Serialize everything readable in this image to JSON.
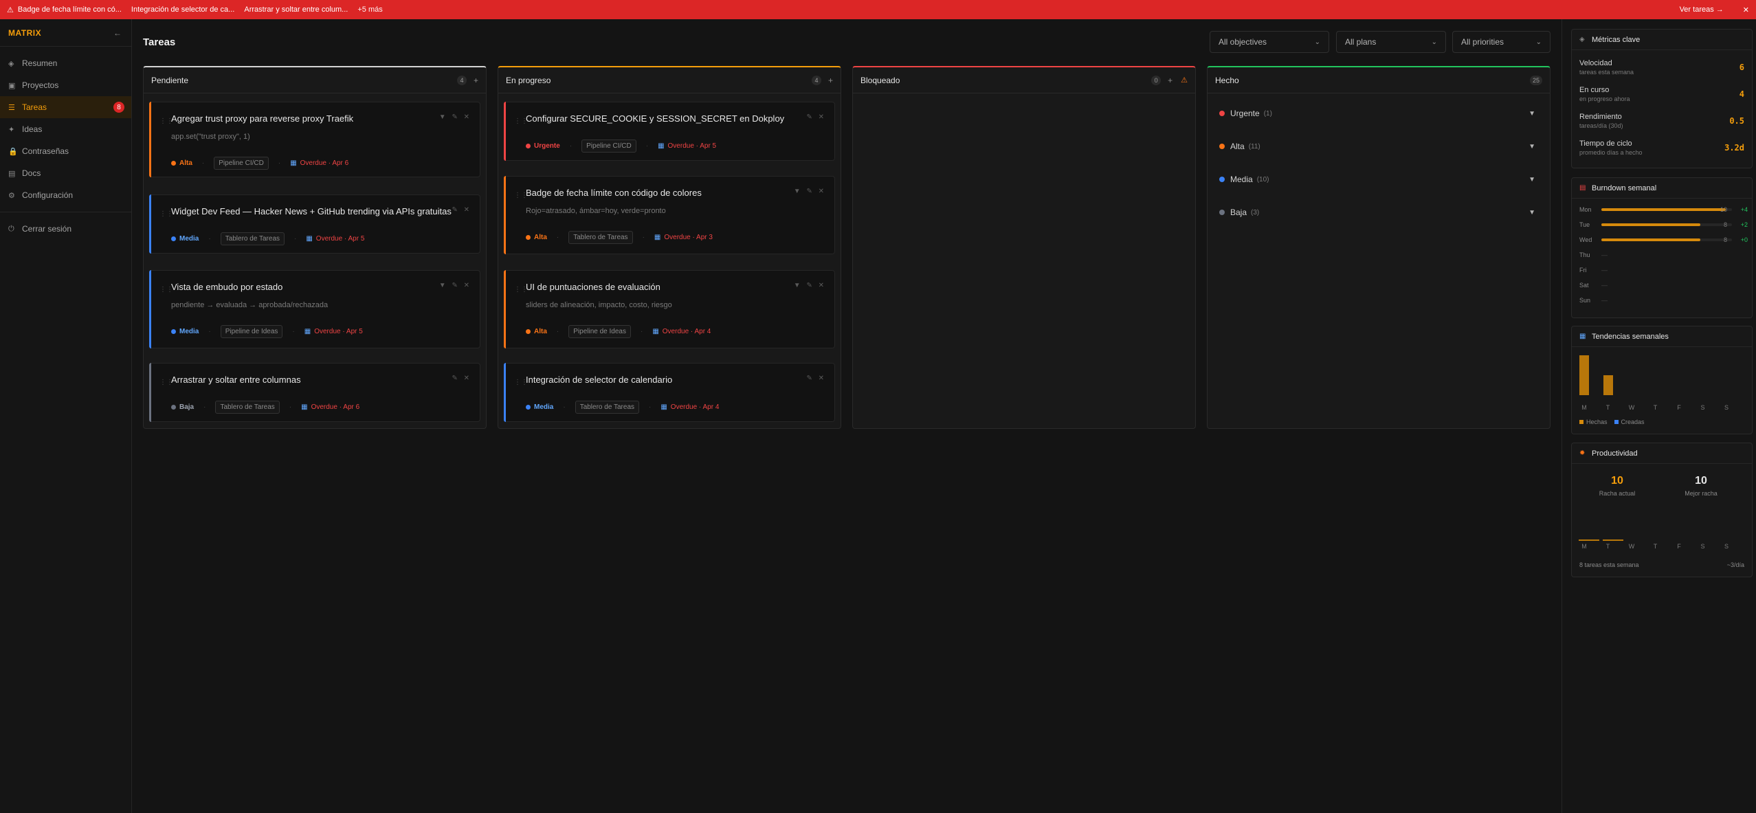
{
  "alerts": {
    "items": [
      "Badge de fecha límite con có...",
      "Integración de selector de ca...",
      "Arrastrar y soltar entre colum..."
    ],
    "more": "+5 más",
    "view": "Ver tareas →",
    "close": "✕"
  },
  "sidebar": {
    "brand": "MATRIX",
    "collapse": "←",
    "items": [
      {
        "label": "Resumen",
        "icon": "◈"
      },
      {
        "label": "Proyectos",
        "icon": "▣"
      },
      {
        "label": "Tareas",
        "icon": "☰",
        "count": "8"
      },
      {
        "label": "Ideas",
        "icon": "✦"
      },
      {
        "label": "Contraseñas",
        "icon": "🔒"
      },
      {
        "label": "Docs",
        "icon": "▤"
      },
      {
        "label": "Configuración",
        "icon": "⚙"
      }
    ],
    "logout": {
      "label": "Cerrar sesión",
      "icon": "⏻"
    }
  },
  "main": {
    "title": "Tareas",
    "filters": {
      "objectives": "All objectives",
      "plans": "All plans",
      "priorities": "All priorities"
    }
  },
  "columns": [
    {
      "title": "Pendiente",
      "count": "4",
      "add": "+",
      "cards": [
        {
          "title": "Agregar trust proxy para reverse proxy Traefik",
          "desc": "app.set(\"trust proxy\", 1)",
          "priority": "Alta",
          "plan": "Pipeline CI/CD",
          "due": "Overdue · Apr 6",
          "actions": "▼ ✎ ✕"
        },
        {
          "title": "Widget Dev Feed — Hacker News + GitHub trending via APIs gratuitas",
          "desc": "",
          "priority": "Media",
          "plan": "Tablero de Tareas",
          "due": "Overdue · Apr 5",
          "actions": "✎ ✕"
        },
        {
          "title": "Vista de embudo por estado",
          "desc": "pendiente → evaluada → aprobada/rechazada",
          "priority": "Media",
          "plan": "Pipeline de Ideas",
          "due": "Overdue · Apr 5",
          "actions": "▼ ✎ ✕"
        },
        {
          "title": "Arrastrar y soltar entre columnas",
          "desc": "",
          "priority": "Baja",
          "plan": "Tablero de Tareas",
          "due": "Overdue · Apr 6",
          "actions": "✎ ✕"
        }
      ]
    },
    {
      "title": "En progreso",
      "count": "4",
      "add": "+",
      "cards": [
        {
          "title": "Configurar SECURE_COOKIE y SESSION_SECRET en Dokploy",
          "desc": "",
          "priority": "Urgente",
          "plan": "Pipeline CI/CD",
          "due": "Overdue · Apr 5",
          "actions": "✎ ✕"
        },
        {
          "title": "Badge de fecha límite con código de colores",
          "desc": "Rojo=atrasado, ámbar=hoy, verde=pronto",
          "priority": "Alta",
          "plan": "Tablero de Tareas",
          "due": "Overdue · Apr 3",
          "actions": "▼ ✎ ✕"
        },
        {
          "title": "UI de puntuaciones de evaluación",
          "desc": "sliders de alineación, impacto, costo, riesgo",
          "priority": "Alta",
          "plan": "Pipeline de Ideas",
          "due": "Overdue · Apr 4",
          "actions": "▼ ✎ ✕"
        },
        {
          "title": "Integración de selector de calendario",
          "desc": "",
          "priority": "Media",
          "plan": "Tablero de Tareas",
          "due": "Overdue · Apr 4",
          "actions": "✎ ✕"
        }
      ]
    },
    {
      "title": "Bloqueado",
      "count": "0",
      "add": "+",
      "warn": "⚠",
      "cards": []
    },
    {
      "title": "Hecho",
      "count": "25",
      "groups": [
        {
          "label": "Urgente",
          "count": "(1)"
        },
        {
          "label": "Alta",
          "count": "(11)"
        },
        {
          "label": "Media",
          "count": "(10)"
        },
        {
          "label": "Baja",
          "count": "(3)"
        }
      ]
    }
  ],
  "priority_colors": {
    "Urgente": "#ef4444",
    "Alta": "#f97316",
    "Media": "#3b82f6",
    "Baja": "#6b7280"
  },
  "metrics": {
    "title": "Métricas clave",
    "items": [
      {
        "label": "Velocidad",
        "sub": "tareas esta semana",
        "value": "6"
      },
      {
        "label": "En curso",
        "sub": "en progreso ahora",
        "value": "4"
      },
      {
        "label": "Rendimiento",
        "sub": "tareas/día (30d)",
        "value": "0.5"
      },
      {
        "label": "Tiempo de ciclo",
        "sub": "promedio días a hecho",
        "value": "3.2d"
      }
    ]
  },
  "burndown": {
    "title": "Burndown semanal",
    "days": [
      {
        "day": "Mon",
        "value": "10",
        "delta": "+4",
        "fill": 0.95
      },
      {
        "day": "Tue",
        "value": "8",
        "delta": "+2",
        "fill": 0.76
      },
      {
        "day": "Wed",
        "value": "8",
        "delta": "+0",
        "fill": 0.76
      },
      {
        "day": "Thu",
        "empty": "—"
      },
      {
        "day": "Fri",
        "empty": "—"
      },
      {
        "day": "Sat",
        "empty": "—"
      },
      {
        "day": "Sun",
        "empty": "—"
      }
    ]
  },
  "trends": {
    "title": "Tendencias semanales",
    "days": [
      "M",
      "T",
      "W",
      "T",
      "F",
      "S",
      "S"
    ],
    "done": [
      10,
      5,
      0,
      0,
      0,
      0,
      0
    ],
    "legend_done": "Hechas",
    "legend_created": "Creadas"
  },
  "productivity": {
    "title": "Productividad",
    "streak": "10",
    "streak_label": "Racha actual",
    "best": "10",
    "best_label": "Mejor racha",
    "days": [
      "M",
      "T",
      "W",
      "T",
      "F",
      "S",
      "S"
    ],
    "footer_left": "8 tareas esta semana",
    "footer_right": "~3/día"
  }
}
